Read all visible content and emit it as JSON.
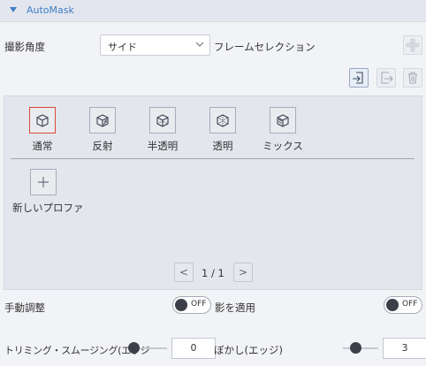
{
  "header": {
    "title": "AutoMask"
  },
  "angle": {
    "label": "撮影角度",
    "selected": "サイド"
  },
  "frame_selection": {
    "label": "フレームセレクション"
  },
  "library": {
    "presets": [
      {
        "label": "通常",
        "icon": "cube-solid-icon",
        "selected": true
      },
      {
        "label": "反射",
        "icon": "cube-reflect-icon",
        "selected": false
      },
      {
        "label": "半透明",
        "icon": "cube-translucent-icon",
        "selected": false
      },
      {
        "label": "透明",
        "icon": "cube-transparent-icon",
        "selected": false
      },
      {
        "label": "ミックス",
        "icon": "cube-mix-icon",
        "selected": false
      }
    ],
    "new_profile_label": "新しいプロファ",
    "pagination": {
      "prev": "<",
      "text": "1 / 1",
      "next": ">"
    }
  },
  "manual_adjust": {
    "label": "手動調整",
    "toggle": "OFF"
  },
  "shadow": {
    "label": "影を適用",
    "toggle": "OFF"
  },
  "trimming": {
    "label": "トリミング・スムージング(エッジ",
    "value": "0",
    "level": 0
  },
  "blur": {
    "label": "ぼかし(エッジ)",
    "value": "3",
    "level": 0.3
  }
}
